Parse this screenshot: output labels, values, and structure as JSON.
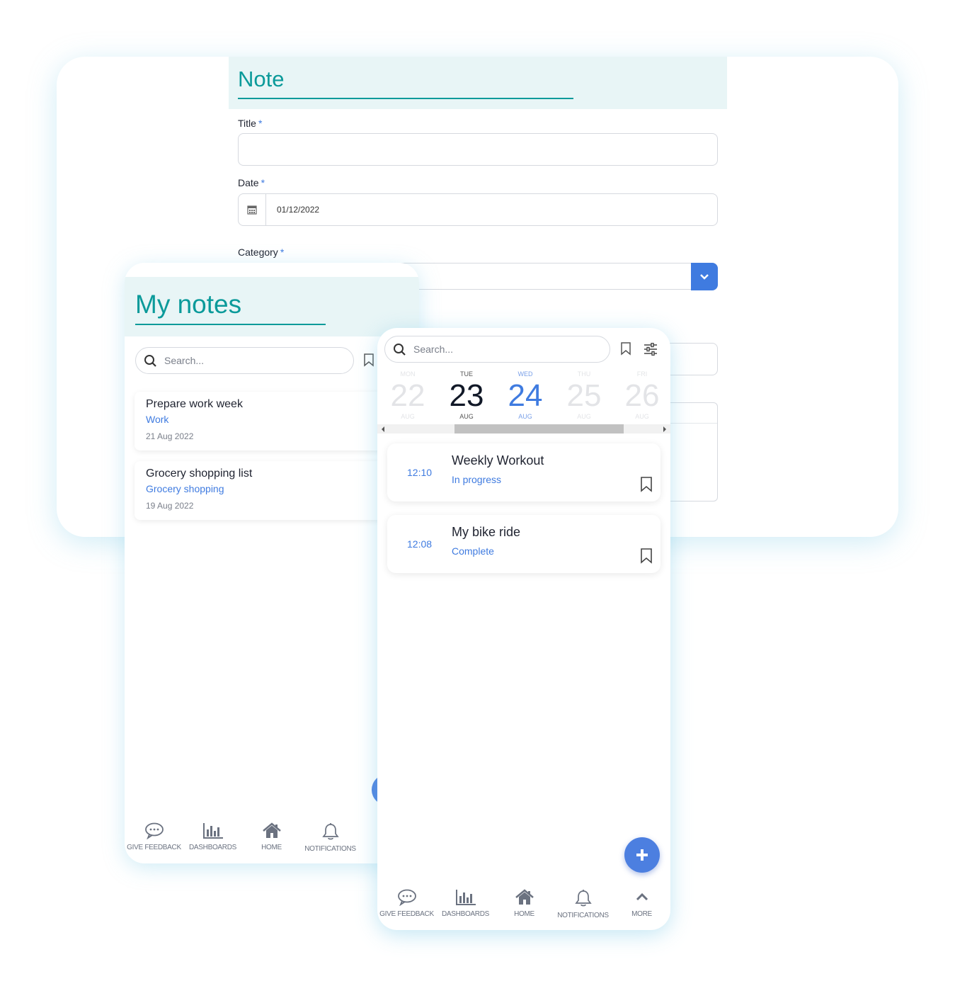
{
  "note_form": {
    "title": "Note",
    "fields": {
      "title_label": "Title",
      "date_label": "Date",
      "date_value": "01/12/2022",
      "category_label": "Category",
      "required_mark": "*"
    }
  },
  "my_notes": {
    "title": "My notes",
    "search_placeholder": "Search...",
    "notes": [
      {
        "title": "Prepare work week",
        "category": "Work",
        "date": "21 Aug 2022"
      },
      {
        "title": "Grocery shopping list",
        "category": "Grocery shopping",
        "date": "19 Aug 2022"
      }
    ],
    "nav": [
      "GIVE FEEDBACK",
      "DASHBOARDS",
      "HOME",
      "NOTIFICATIONS"
    ]
  },
  "calendar": {
    "search_placeholder": "Search...",
    "days": [
      {
        "name": "MON",
        "num": "22",
        "month": "AUG",
        "state": "faded"
      },
      {
        "name": "TUE",
        "num": "23",
        "month": "AUG",
        "state": "today"
      },
      {
        "name": "WED",
        "num": "24",
        "month": "AUG",
        "state": "selected"
      },
      {
        "name": "THU",
        "num": "25",
        "month": "AUG",
        "state": "faded"
      },
      {
        "name": "FRI",
        "num": "26",
        "month": "AUG",
        "state": "faded"
      }
    ],
    "activities": [
      {
        "time": "12:10",
        "title": "Weekly Workout",
        "status": "In progress"
      },
      {
        "time": "12:08",
        "title": "My bike ride",
        "status": "Complete"
      }
    ],
    "nav": [
      "GIVE FEEDBACK",
      "DASHBOARDS",
      "HOME",
      "NOTIFICATIONS",
      "MORE"
    ]
  },
  "colors": {
    "accent": "#3f7be0",
    "teal": "#0b9a9a",
    "header_bg": "#e8f5f6"
  }
}
